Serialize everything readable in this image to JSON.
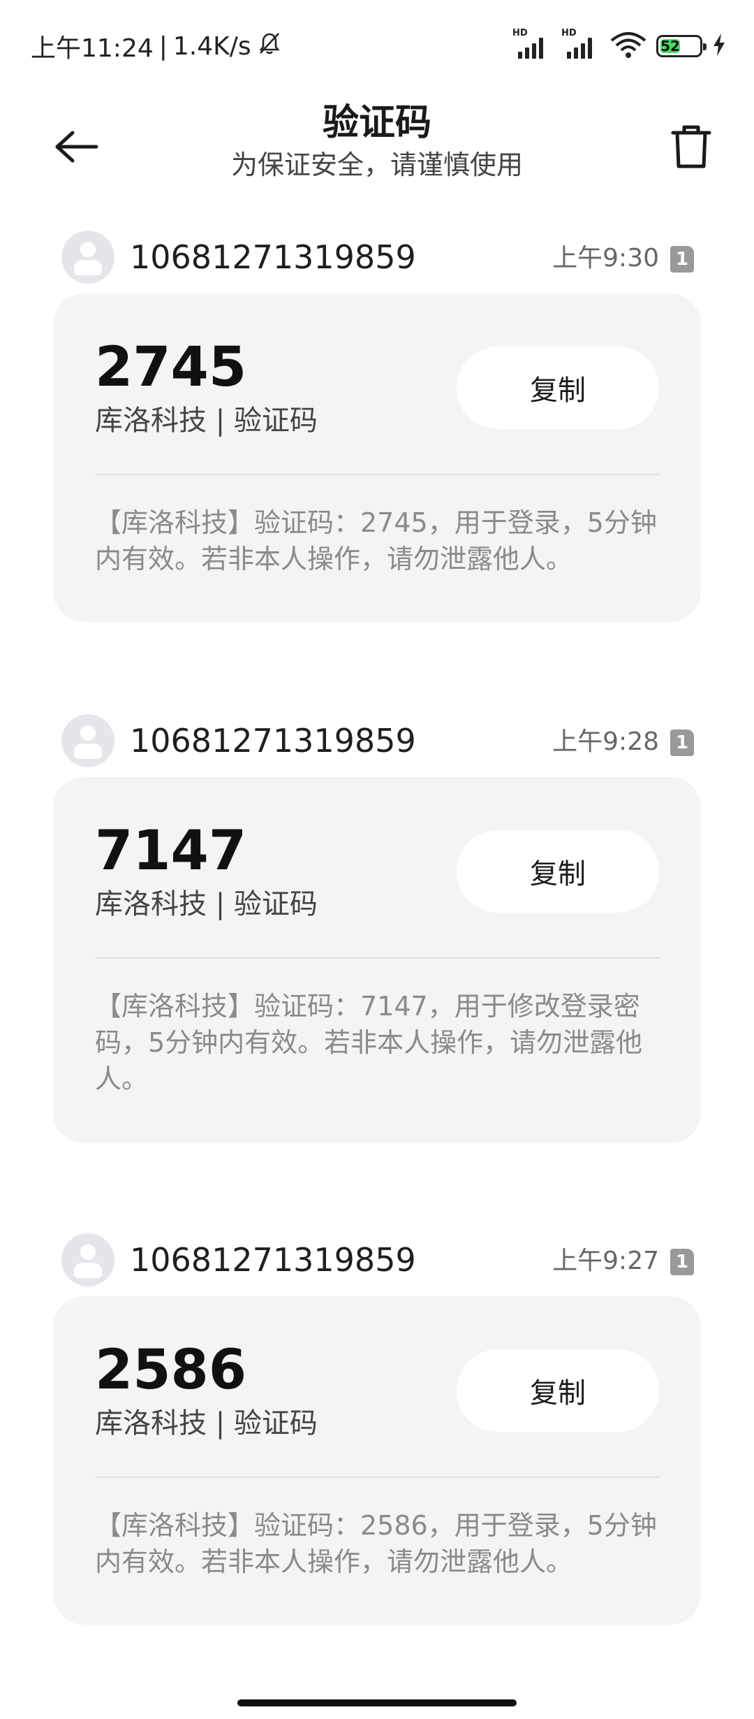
{
  "status_bar": {
    "time": "上午11:24",
    "separator": "|",
    "net_speed": "1.4K/s",
    "signal1_label": "HD",
    "signal2_label": "HD",
    "battery_level": "52"
  },
  "header": {
    "title": "验证码",
    "subtitle": "为保证安全，请谨慎使用"
  },
  "messages": [
    {
      "sender": "10681271319859",
      "time": "上午9:30",
      "sim": "1",
      "code": "2745",
      "label": "库洛科技 | 验证码",
      "copy_label": "复制",
      "text": "【库洛科技】验证码：2745，用于登录，5分钟内有效。若非本人操作，请勿泄露他人。"
    },
    {
      "sender": "10681271319859",
      "time": "上午9:28",
      "sim": "1",
      "code": "7147",
      "label": "库洛科技 | 验证码",
      "copy_label": "复制",
      "text": "【库洛科技】验证码：7147，用于修改登录密码，5分钟内有效。若非本人操作，请勿泄露他人。"
    },
    {
      "sender": "10681271319859",
      "time": "上午9:27",
      "sim": "1",
      "code": "2586",
      "label": "库洛科技 | 验证码",
      "copy_label": "复制",
      "text": "【库洛科技】验证码：2586，用于登录，5分钟内有效。若非本人操作，请勿泄露他人。"
    }
  ],
  "colors": {
    "card_bg": "#f4f4f4",
    "battery_fill": "#4cd964"
  },
  "icons": [
    "back-arrow-icon",
    "trash-icon",
    "mute-bell-icon",
    "wifi-icon",
    "charging-icon",
    "avatar-icon",
    "sim-card-icon"
  ]
}
